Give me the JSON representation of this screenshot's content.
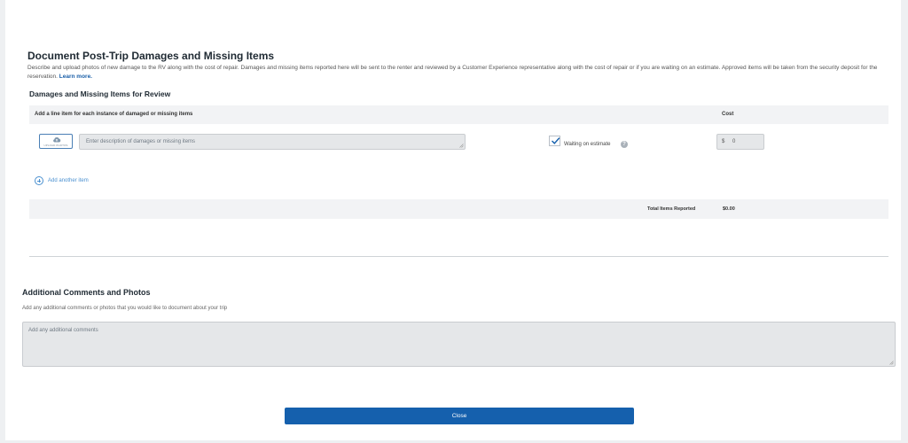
{
  "document": {
    "title": "Document Post-Trip Damages and Missing Items",
    "description": "Describe and upload photos of new damage to the RV along with the cost of repair. Damages and missing items reported here will be sent to the renter and reviewed by a Customer Experience representative along with the cost of repair or if you are waiting on an estimate. Approved items will be taken from the security deposit for the reservation.",
    "learn_more": "Learn more."
  },
  "review": {
    "title": "Damages and Missing Items for Review",
    "columns": {
      "items": "Add a line item for each instance of damaged or missing items",
      "cost": "Cost"
    },
    "line_item": {
      "upload_label": "UPLOAD PHOTOS",
      "upload_icon": "cloud-upload-icon",
      "description_placeholder": "Enter description of damages or missing items",
      "waiting_checked": true,
      "waiting_label": "Waiting on estimate",
      "help_icon": "question-icon",
      "help_glyph": "?",
      "currency_symbol": "$",
      "cost_value": "0"
    },
    "add_another": "Add another item",
    "total_label": "Total Items Reported",
    "total_value": "$0.00"
  },
  "additional": {
    "title": "Additional Comments and Photos",
    "description": "Add any additional comments or photos that you would like to document about your trip",
    "comments_placeholder": "Add any additional comments"
  },
  "close_label": "Close",
  "colors": {
    "primary": "#1560ad",
    "link": "#4a90d0",
    "input_bg": "#e5e7e9"
  }
}
